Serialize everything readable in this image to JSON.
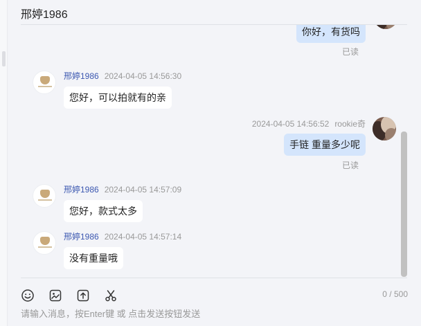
{
  "header": {
    "title": "邢婷1986"
  },
  "messages": [
    {
      "side": "right",
      "text": "你好，有货吗",
      "read": "已读"
    },
    {
      "side": "left",
      "sender": "邢婷1986",
      "time": "2024-04-05 14:56:30",
      "text": "您好，可以拍就有的亲"
    },
    {
      "side": "right",
      "sender": "rookie奇",
      "time": "2024-04-05 14:56:52",
      "text": "手链  重量多少呢",
      "read": "已读"
    },
    {
      "side": "left",
      "sender": "邢婷1986",
      "time": "2024-04-05 14:57:09",
      "text": "您好，款式太多"
    },
    {
      "side": "left",
      "sender": "邢婷1986",
      "time": "2024-04-05 14:57:14",
      "text": "没有重量哦"
    }
  ],
  "toolbar": {
    "icons": [
      "emoji-icon",
      "image-icon",
      "upload-icon",
      "scissors-icon"
    ]
  },
  "input": {
    "placeholder": "请输入消息，按Enter键 或 点击发送按钮发送",
    "value": "",
    "counter": "0 / 500"
  },
  "colors": {
    "bubble_right": "#d4e5fc",
    "bubble_left": "#ffffff",
    "sender_name": "#3b57b0",
    "background": "#f3f4f8"
  }
}
